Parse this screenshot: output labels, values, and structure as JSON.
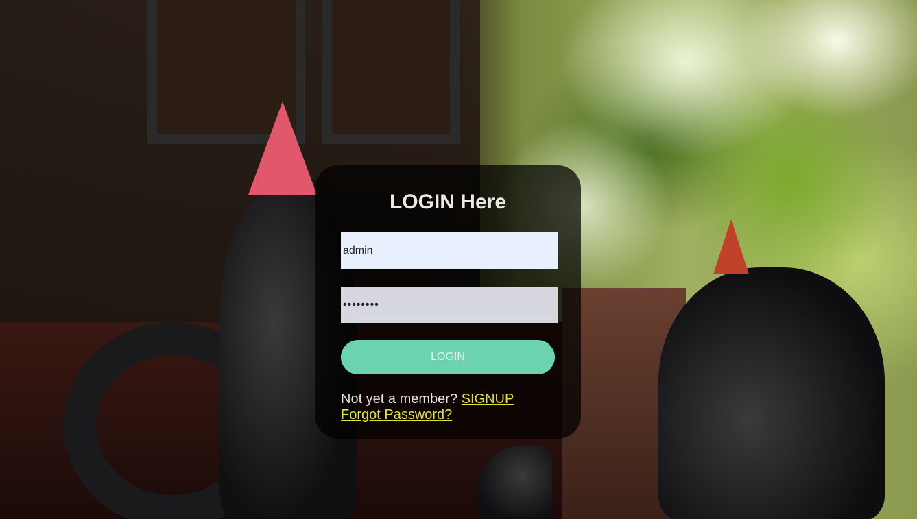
{
  "login_card": {
    "title": "LOGIN Here",
    "username_value": "admin",
    "password_value": "••••••••",
    "login_button_label": "LOGIN",
    "signup_prompt": "Not yet a member?",
    "signup_link": "SIGNUP",
    "forgot_password_link": "Forgot Password?"
  },
  "colors": {
    "button": "#6cd3b0",
    "link": "#e3e030",
    "card_background": "rgba(0,0,0,0.72)"
  },
  "icons": []
}
